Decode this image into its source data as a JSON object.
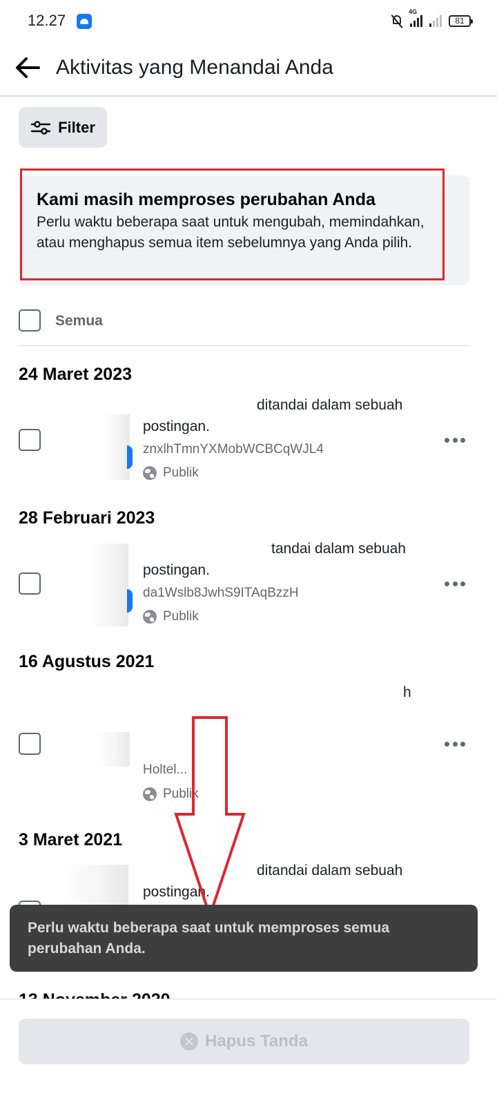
{
  "status_bar": {
    "time": "12.27",
    "network": "4G",
    "battery": "81"
  },
  "header": {
    "title": "Aktivitas yang Menandai Anda"
  },
  "filter": {
    "label": "Filter"
  },
  "notice": {
    "title": "Kami masih memproses perubahan Anda",
    "body": "Perlu waktu beberapa saat untuk mengubah, memindahkan, atau menghapus semua item sebelumnya yang Anda pilih."
  },
  "select_all": {
    "label": "Semua"
  },
  "sections": [
    {
      "date": "24 Maret 2023",
      "desc_line1": "ditandai dalam sebuah",
      "desc_line2": "postingan.",
      "id_text": "znxlhTmnYXMobWCBCqWJL4",
      "privacy": "Publik"
    },
    {
      "date": "28 Februari 2023",
      "desc_line1": "tandai dalam sebuah",
      "desc_line2": "postingan.",
      "id_text": "da1Wslb8JwhS9ITAqBzzH",
      "privacy": "Publik"
    },
    {
      "date": "16 Agustus 2021",
      "desc_line1": "h",
      "id_text": "Holtel...",
      "privacy": "Publik"
    },
    {
      "date": "3 Maret 2021",
      "desc_line1": "ditandai dalam sebuah",
      "desc_line2": "postingan."
    }
  ],
  "toast": {
    "message": "Perlu waktu beberapa saat untuk memproses semua perubahan Anda."
  },
  "next_section_peek": "13 November 2020",
  "bottom": {
    "remove_label": "Hapus Tanda"
  },
  "colors": {
    "accent": "#1877f2",
    "highlight": "#e0262f",
    "toast_bg": "#3e3e3e"
  }
}
